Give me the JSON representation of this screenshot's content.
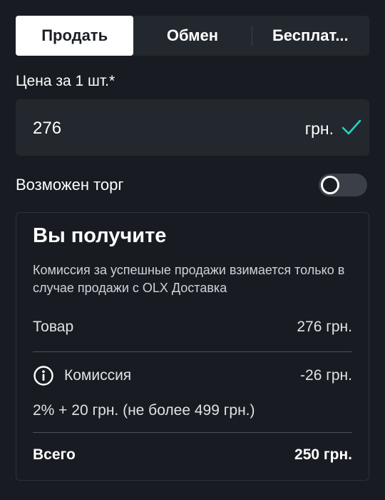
{
  "tabs": [
    {
      "label": "Продать",
      "active": true
    },
    {
      "label": "Обмен",
      "active": false
    },
    {
      "label": "Бесплат...",
      "active": false
    }
  ],
  "price": {
    "label": "Цена за 1 шт.*",
    "value": "276",
    "unit": "грн.",
    "valid_icon": "check-icon"
  },
  "negotiable": {
    "label": "Возможен торг",
    "enabled": false
  },
  "summary": {
    "title": "Вы получите",
    "description": "Комиссия за успешные продажи взимается только в случае продажи с OLX Доставка",
    "goods_label": "Товар",
    "goods_value": "276 грн.",
    "fee_label": "Комиссия",
    "fee_value": "-26 грн.",
    "fee_formula": "2% + 20 грн. (не более 499 грн.)",
    "total_label": "Всего",
    "total_value": "250 грн."
  },
  "colors": {
    "background": "#181c22",
    "field": "#23272e",
    "accent_check": "#2ad1c0"
  }
}
